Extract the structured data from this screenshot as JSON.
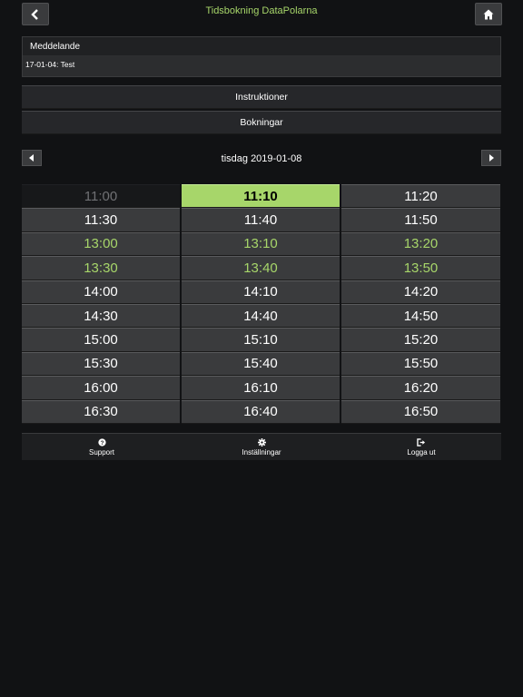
{
  "header": {
    "title": "Tidsbokning DataPolarna",
    "back_icon": "chevron-left-icon",
    "home_icon": "home-icon"
  },
  "message_panel": {
    "title": "Meddelande",
    "text": "17-01-04: Test"
  },
  "menu": {
    "instructions_label": "Instruktioner",
    "bookings_label": "Bokningar"
  },
  "date_nav": {
    "date": "tisdag 2019-01-08",
    "prev_icon": "chevron-left-icon",
    "next_icon": "chevron-right-icon"
  },
  "colors": {
    "accent": "#a7d66a",
    "slot_bg": "#3a3b3d",
    "unavailable_bg": "#17181a"
  },
  "slots": [
    {
      "time": "11:00",
      "state": "unavailable"
    },
    {
      "time": "11:10",
      "state": "selected"
    },
    {
      "time": "11:20",
      "state": "normal"
    },
    {
      "time": "11:30",
      "state": "normal"
    },
    {
      "time": "11:40",
      "state": "normal"
    },
    {
      "time": "11:50",
      "state": "normal"
    },
    {
      "time": "13:00",
      "state": "green"
    },
    {
      "time": "13:10",
      "state": "green"
    },
    {
      "time": "13:20",
      "state": "green"
    },
    {
      "time": "13:30",
      "state": "green"
    },
    {
      "time": "13:40",
      "state": "green"
    },
    {
      "time": "13:50",
      "state": "green"
    },
    {
      "time": "14:00",
      "state": "normal"
    },
    {
      "time": "14:10",
      "state": "normal"
    },
    {
      "time": "14:20",
      "state": "normal"
    },
    {
      "time": "14:30",
      "state": "normal"
    },
    {
      "time": "14:40",
      "state": "normal"
    },
    {
      "time": "14:50",
      "state": "normal"
    },
    {
      "time": "15:00",
      "state": "normal"
    },
    {
      "time": "15:10",
      "state": "normal"
    },
    {
      "time": "15:20",
      "state": "normal"
    },
    {
      "time": "15:30",
      "state": "normal"
    },
    {
      "time": "15:40",
      "state": "normal"
    },
    {
      "time": "15:50",
      "state": "normal"
    },
    {
      "time": "16:00",
      "state": "normal"
    },
    {
      "time": "16:10",
      "state": "normal"
    },
    {
      "time": "16:20",
      "state": "normal"
    },
    {
      "time": "16:30",
      "state": "normal"
    },
    {
      "time": "16:40",
      "state": "normal"
    },
    {
      "time": "16:50",
      "state": "normal"
    }
  ],
  "bottom_nav": {
    "support_label": "Support",
    "support_icon": "question-circle-icon",
    "settings_label": "Inställningar",
    "settings_icon": "gear-icon",
    "logout_label": "Logga ut",
    "logout_icon": "sign-out-icon"
  }
}
